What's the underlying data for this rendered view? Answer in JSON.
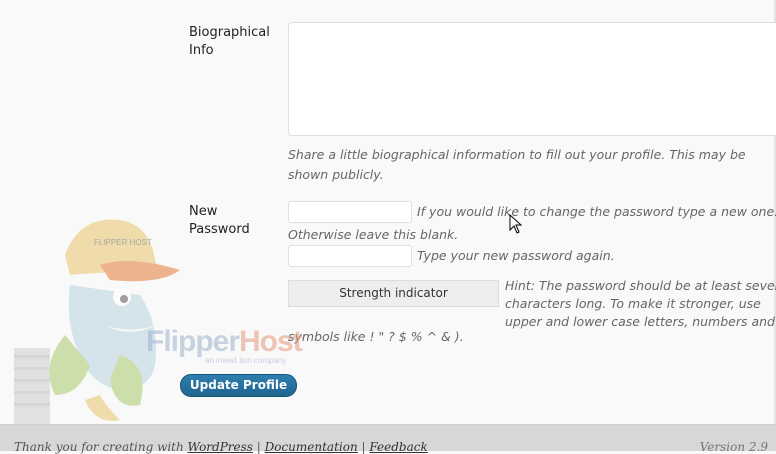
{
  "bio": {
    "label": "Biographical Info",
    "description": "Share a little biographical information to fill out your profile. This may be shown publicly."
  },
  "password": {
    "label": "New Password",
    "hint1_a": "If you would like to change the password type a new one.",
    "hint1_b": "Otherwise leave this blank.",
    "hint2": "Type your new password again.",
    "strength_label": "Strength indicator",
    "hint3_a": "Hint: The password should be at least seven",
    "hint3_b": "characters long. To make it stronger, use",
    "hint3_c": "upper and lower case letters, numbers and",
    "hint3_d": "symbols like ! \" ? $ % ^ & )."
  },
  "update_button": "Update Profile",
  "watermark": {
    "brand_a": "Flipper",
    "brand_b": "Host",
    "tagline": "an invest lion company",
    "cap_text": "FLIPPER HOST"
  },
  "footer": {
    "thanks": "Thank you for creating with ",
    "wordpress": "WordPress",
    "sep1": " | ",
    "documentation": "Documentation",
    "sep2": " | ",
    "feedback": "Feedback",
    "version": "Version 2.9"
  }
}
